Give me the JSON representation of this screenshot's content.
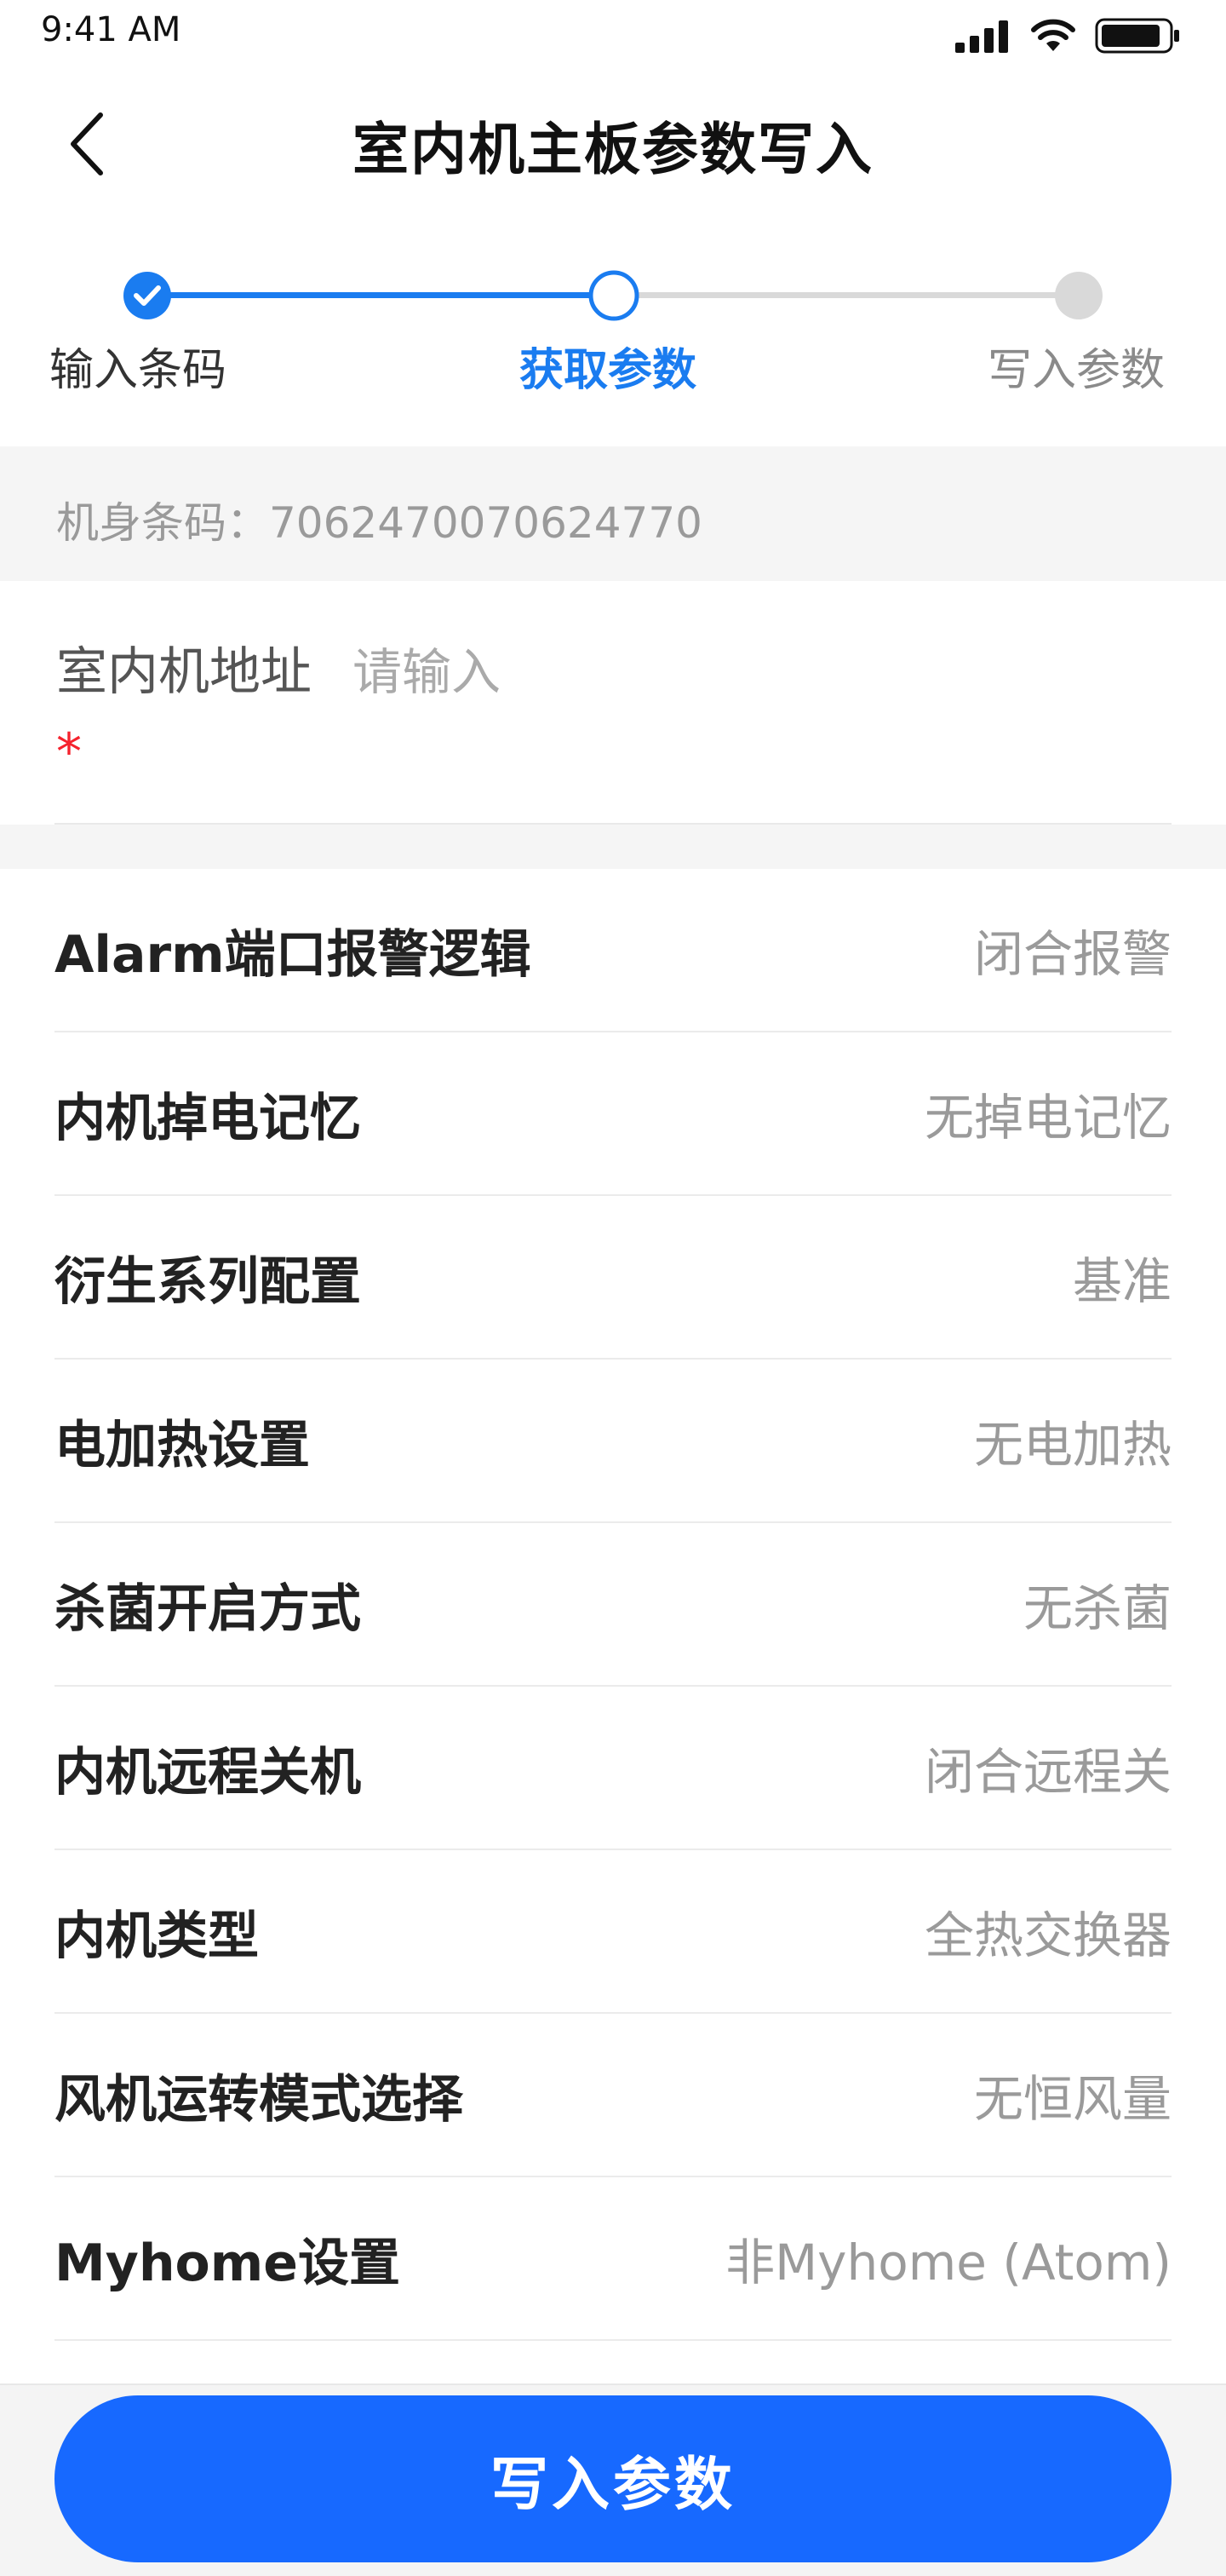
{
  "status_bar": {
    "time": "9:41 AM"
  },
  "nav": {
    "title": "室内机主板参数写入"
  },
  "stepper": {
    "steps": [
      {
        "label": "输入条码",
        "state": "done"
      },
      {
        "label": "获取参数",
        "state": "active"
      },
      {
        "label": "写入参数",
        "state": "pending"
      }
    ],
    "colors": {
      "active": "#1a7cf0",
      "pending": "#d9d9d9",
      "done_text": "#333333",
      "pending_text": "#8a8a8a"
    }
  },
  "barcode": {
    "label": "机身条码：",
    "value": "7062470070624770"
  },
  "address": {
    "label": "室内机地址",
    "required_mark": "*",
    "placeholder": "请输入",
    "value": ""
  },
  "params": [
    {
      "label": "Alarm端口报警逻辑",
      "value": "闭合报警"
    },
    {
      "label": "内机掉电记忆",
      "value": "无掉电记忆"
    },
    {
      "label": "衍生系列配置",
      "value": "基准"
    },
    {
      "label": "电加热设置",
      "value": "无电加热"
    },
    {
      "label": "杀菌开启方式",
      "value": "无杀菌"
    },
    {
      "label": "内机远程关机",
      "value": "闭合远程关"
    },
    {
      "label": "内机类型",
      "value": "全热交换器"
    },
    {
      "label": "风机运转模式选择",
      "value": "无恒风量"
    },
    {
      "label": "Myhome设置",
      "value": "非Myhome (Atom)"
    }
  ],
  "footer": {
    "button_label": "写入参数",
    "button_color": "#1769ff"
  }
}
